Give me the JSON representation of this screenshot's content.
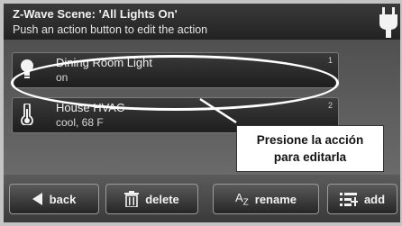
{
  "header": {
    "title": "Z-Wave Scene: 'All Lights On'",
    "subtitle": "Push an action button to edit the action",
    "icon": "plug-icon"
  },
  "actions": [
    {
      "name": "Dining Room Light",
      "state": "on",
      "number": "1",
      "icon": "bulb-icon"
    },
    {
      "name": "House HVAC",
      "state": "cool, 68 F",
      "number": "2",
      "icon": "thermometer-icon"
    }
  ],
  "callout": {
    "line1": "Presione la acción",
    "line2": "para editarla"
  },
  "toolbar": {
    "back_label": "back",
    "delete_label": "delete",
    "rename_icon_letter": "A",
    "rename_icon_sub": "Z",
    "rename_label": "rename",
    "add_label": "add"
  }
}
